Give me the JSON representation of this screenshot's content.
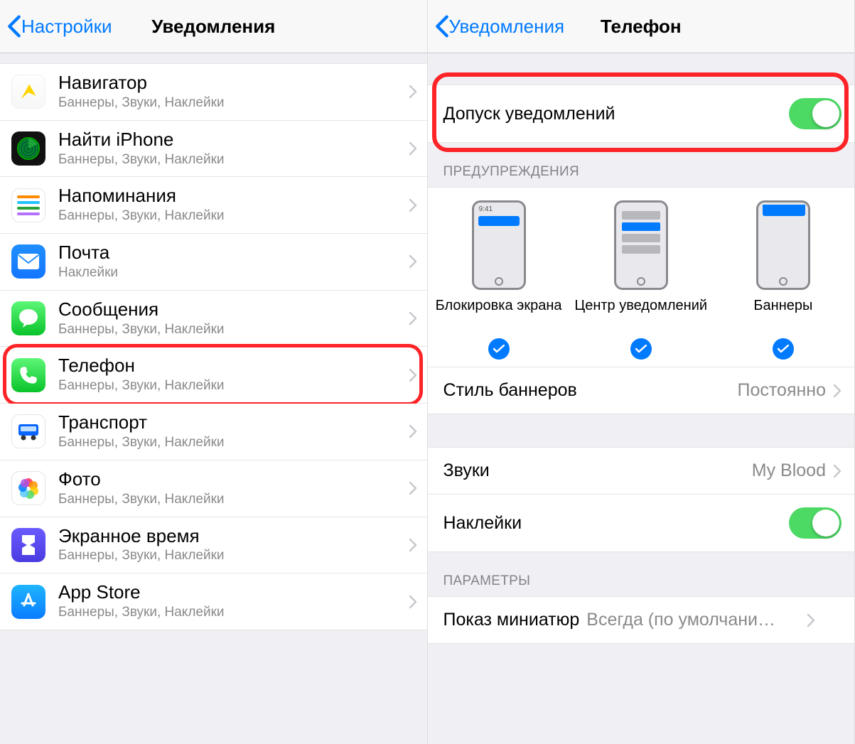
{
  "left": {
    "back_label": "Настройки",
    "title": "Уведомления",
    "apps": [
      {
        "id": "navigator",
        "title": "Навигатор",
        "sub": "Баннеры, Звуки, Наклейки"
      },
      {
        "id": "find-iphone",
        "title": "Найти iPhone",
        "sub": "Баннеры, Звуки, Наклейки"
      },
      {
        "id": "reminders",
        "title": "Напоминания",
        "sub": "Баннеры, Звуки, Наклейки"
      },
      {
        "id": "mail",
        "title": "Почта",
        "sub": "Наклейки"
      },
      {
        "id": "messages",
        "title": "Сообщения",
        "sub": "Баннеры, Звуки, Наклейки"
      },
      {
        "id": "phone",
        "title": "Телефон",
        "sub": "Баннеры, Звуки, Наклейки"
      },
      {
        "id": "transport",
        "title": "Транспорт",
        "sub": "Баннеры, Звуки, Наклейки"
      },
      {
        "id": "photos",
        "title": "Фото",
        "sub": "Баннеры, Звуки, Наклейки"
      },
      {
        "id": "screen-time",
        "title": "Экранное время",
        "sub": "Баннеры, Звуки, Наклейки"
      },
      {
        "id": "app-store",
        "title": "App Store",
        "sub": "Баннеры, Звуки, Наклейки"
      }
    ]
  },
  "right": {
    "back_label": "Уведомления",
    "title": "Телефон",
    "allow_label": "Допуск уведомлений",
    "section_alerts": "ПРЕДУПРЕЖДЕНИЯ",
    "lock_time": "9:41",
    "alert_lock": "Блокировка экрана",
    "alert_center": "Центр уведомлений",
    "alert_banners": "Баннеры",
    "banner_style_label": "Стиль баннеров",
    "banner_style_value": "Постоянно",
    "sounds_label": "Звуки",
    "sounds_value": "My Blood",
    "stickers_label": "Наклейки",
    "section_params": "ПАРАМЕТРЫ",
    "previews_label": "Показ миниатюр",
    "previews_value": "Всегда (по умолчани…"
  }
}
